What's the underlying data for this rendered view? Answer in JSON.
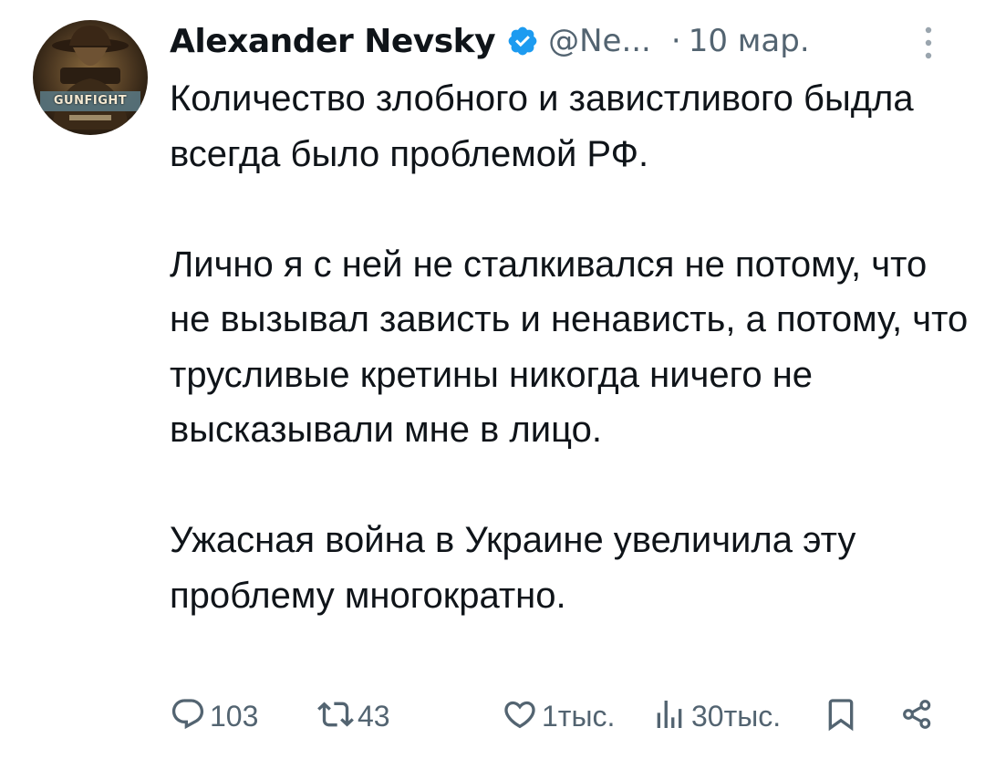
{
  "author": {
    "display_name": "Alexander Nevsky",
    "handle": "@Ne...",
    "separator": "·",
    "timestamp": "10 мар.",
    "verified": true,
    "avatar_title": "GUNFIGHT"
  },
  "tweet": {
    "paragraphs": [
      "Количество злобного и завистливого быдла всегда было проблемой РФ.",
      "Лично я с ней не сталкивался не потому, что не вызывал зависть и ненависть, а потому, что трусливые кретины никогда ничего не высказывали мне в лицо.",
      "Ужасная война в Украине увеличила эту проблему многократно."
    ]
  },
  "actions": {
    "reply": {
      "icon": "reply-icon",
      "count": "103"
    },
    "retweet": {
      "icon": "retweet-icon",
      "count": "43"
    },
    "like": {
      "icon": "heart-icon",
      "count": "1тыс."
    },
    "views": {
      "icon": "views-icon",
      "count": "30тыс."
    },
    "bookmark": {
      "icon": "bookmark-icon"
    },
    "share": {
      "icon": "share-icon"
    }
  },
  "colors": {
    "text": "#0f1419",
    "secondary": "#536471",
    "verified": "#1d9bf0",
    "background": "#ffffff"
  }
}
